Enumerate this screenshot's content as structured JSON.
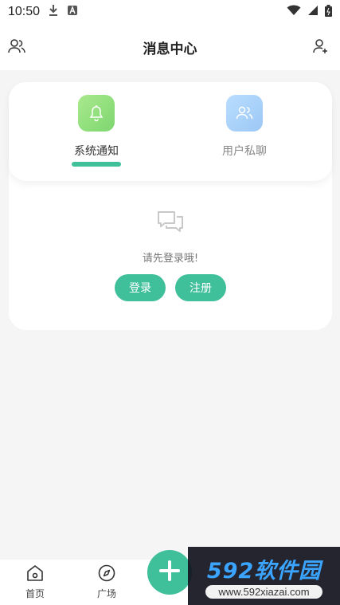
{
  "status_bar": {
    "time": "10:50"
  },
  "header": {
    "title": "消息中心",
    "left_icon": "friends-icon",
    "right_icon": "add-user-icon"
  },
  "tabs": [
    {
      "label": "系统通知",
      "icon": "bell-icon",
      "active": true
    },
    {
      "label": "用户私聊",
      "icon": "users-icon",
      "active": false
    }
  ],
  "empty_state": {
    "icon": "chat-bubbles-icon",
    "message": "请先登录哦!",
    "login_label": "登录",
    "register_label": "注册"
  },
  "bottom_nav": {
    "home_label": "首页",
    "square_label": "广场"
  },
  "watermark": {
    "main": "592软件园",
    "sub": "www.592xiazai.com"
  },
  "colors": {
    "accent": "#3fbf9a",
    "background": "#f5f5f5"
  }
}
